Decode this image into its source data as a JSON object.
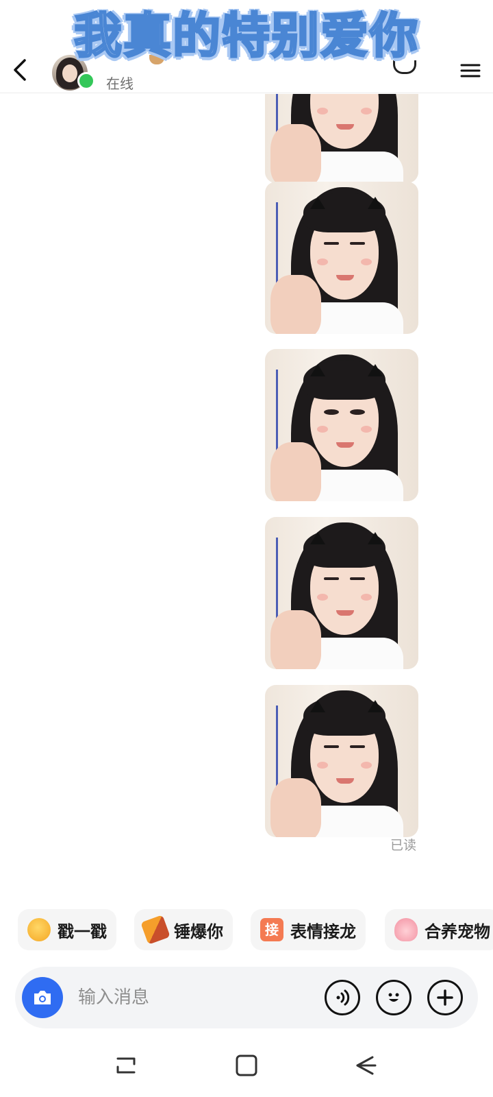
{
  "header": {
    "status_text": "在线"
  },
  "overlay": {
    "caption": "我真的特别爱你"
  },
  "chat": {
    "stickers": [
      {
        "kind": "sticker-image"
      },
      {
        "kind": "sticker-image"
      },
      {
        "kind": "sticker-image"
      },
      {
        "kind": "sticker-image"
      },
      {
        "kind": "sticker-image"
      }
    ],
    "read_status": "已读"
  },
  "quick_actions": [
    {
      "label": "戳一戳",
      "icon": "poke-emoji-icon"
    },
    {
      "label": "锤爆你",
      "icon": "hammer-icon"
    },
    {
      "label": "表情接龙",
      "icon": "jielong-icon",
      "icon_text": "接"
    },
    {
      "label": "合养宠物",
      "icon": "pet-icon"
    }
  ],
  "input_bar": {
    "placeholder": "输入消息",
    "camera_icon": "camera-icon",
    "voice_icon": "voice-icon",
    "emoji_icon": "smiley-icon",
    "plus_icon": "plus-icon"
  },
  "colors": {
    "accent_blue": "#2f6cf2",
    "online_green": "#34c759",
    "banner_outline": "#4a86d4"
  }
}
